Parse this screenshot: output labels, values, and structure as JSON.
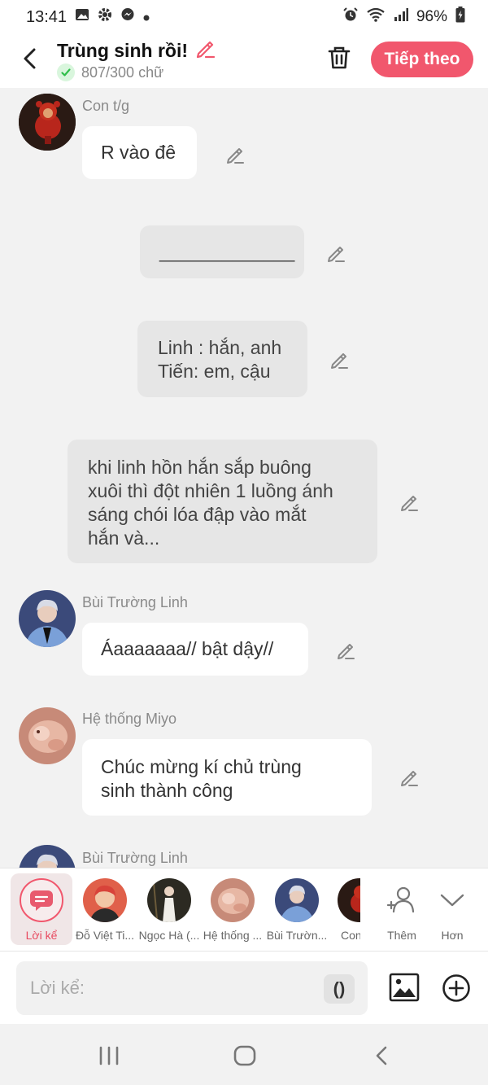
{
  "status_bar": {
    "time": "13:41",
    "battery": "96%"
  },
  "header": {
    "title": "Trùng sinh rồi!",
    "word_count": "807/300 chữ",
    "next_button": "Tiếp theo"
  },
  "messages": [
    {
      "name": "Con t/g",
      "text": "R vào đê"
    },
    {
      "text": "_____________"
    },
    {
      "line1": "Linh : hắn, anh",
      "line2": "Tiến: em, cậu"
    },
    {
      "line1": "khi linh hồn hắn sắp buông",
      "line2": "xuôi thì đột nhiên 1 luồng ánh",
      "line3": "sáng chói lóa đập vào mắt",
      "line4": "hắn và..."
    },
    {
      "name": "Bùi Trường Linh",
      "text": "Áaaaaaaa// bật dậy//"
    },
    {
      "name": "Hệ thống Miyo",
      "line1": "Chúc mừng kí chủ trùng",
      "line2": "sinh thành công"
    },
    {
      "name": "Bùi Trường Linh"
    }
  ],
  "characters": [
    {
      "label": "Lời kể"
    },
    {
      "label": "Đỗ Việt Ti..."
    },
    {
      "label": "Ngọc Hà (..."
    },
    {
      "label": "Hệ thống ..."
    },
    {
      "label": "Bùi Trườn..."
    },
    {
      "label": "Con"
    },
    {
      "label": "Thêm"
    },
    {
      "label": "Hơn"
    }
  ],
  "input": {
    "placeholder": "Lời kể:",
    "paren_label": "()"
  },
  "colors": {
    "accent": "#f1576d",
    "narration_bg": "#e6e6e6",
    "background": "#f2f2f2"
  }
}
